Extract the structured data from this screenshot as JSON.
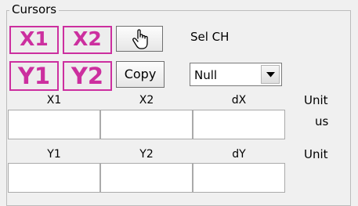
{
  "group": {
    "title": "Cursors"
  },
  "buttons": {
    "x1": "X1",
    "x2": "X2",
    "y1": "Y1",
    "y2": "Y2",
    "copy": "Copy",
    "hand_icon": "hand-pointer-icon"
  },
  "sel_ch": {
    "label": "Sel CH",
    "selected": "Null"
  },
  "x_section": {
    "headers": [
      "X1",
      "X2",
      "dX"
    ],
    "unit_label": "Unit",
    "unit_value": "us",
    "values": [
      "",
      "",
      ""
    ]
  },
  "y_section": {
    "headers": [
      "Y1",
      "Y2",
      "dY"
    ],
    "unit_label": "Unit",
    "values": [
      "",
      "",
      ""
    ]
  },
  "colors": {
    "cursor_button_accent": "#cc2f9f",
    "background": "#f0f0f0"
  }
}
